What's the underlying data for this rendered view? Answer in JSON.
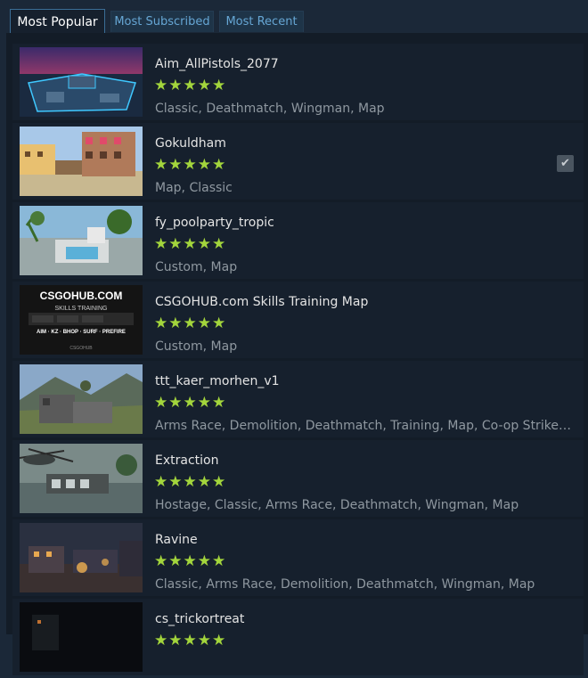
{
  "tabs": [
    {
      "label": "Most Popular"
    },
    {
      "label": "Most Subscribed"
    },
    {
      "label": "Most Recent"
    }
  ],
  "items": [
    {
      "title": "Aim_AllPistols_2077",
      "rating": 5,
      "tags": "Classic, Deathmatch, Wingman, Map",
      "subscribed": false
    },
    {
      "title": "Gokuldham",
      "rating": 5,
      "tags": "Map, Classic",
      "subscribed": true
    },
    {
      "title": "fy_poolparty_tropic",
      "rating": 5,
      "tags": "Custom, Map",
      "subscribed": false
    },
    {
      "title": "CSGOHUB.com Skills Training Map",
      "rating": 5,
      "tags": "Custom, Map",
      "subscribed": false,
      "thumb_text": {
        "brand": "CSGOHUB.COM",
        "subtitle": "SKILLS TRAINING",
        "modes": "AIM · KZ · BHOP · SURF · PREFIRE",
        "footer": "CSGOHUB"
      }
    },
    {
      "title": "ttt_kaer_morhen_v1",
      "rating": 5,
      "tags": "Arms Race, Demolition, Deathmatch, Training, Map, Co-op Strike, Wingman",
      "subscribed": false
    },
    {
      "title": "Extraction",
      "rating": 5,
      "tags": "Hostage, Classic, Arms Race, Deathmatch, Wingman, Map",
      "subscribed": false
    },
    {
      "title": "Ravine",
      "rating": 5,
      "tags": "Classic, Arms Race, Demolition, Deathmatch, Wingman, Map",
      "subscribed": false
    },
    {
      "title": "cs_trickortreat",
      "rating": 5,
      "tags": "",
      "subscribed": false
    }
  ],
  "rating_glyphs": "★★★★★",
  "check_glyph": "✔",
  "colors": {
    "accent_stars": "#a3d53c",
    "tab_link": "#66a6d4",
    "background": "#1b2838"
  }
}
